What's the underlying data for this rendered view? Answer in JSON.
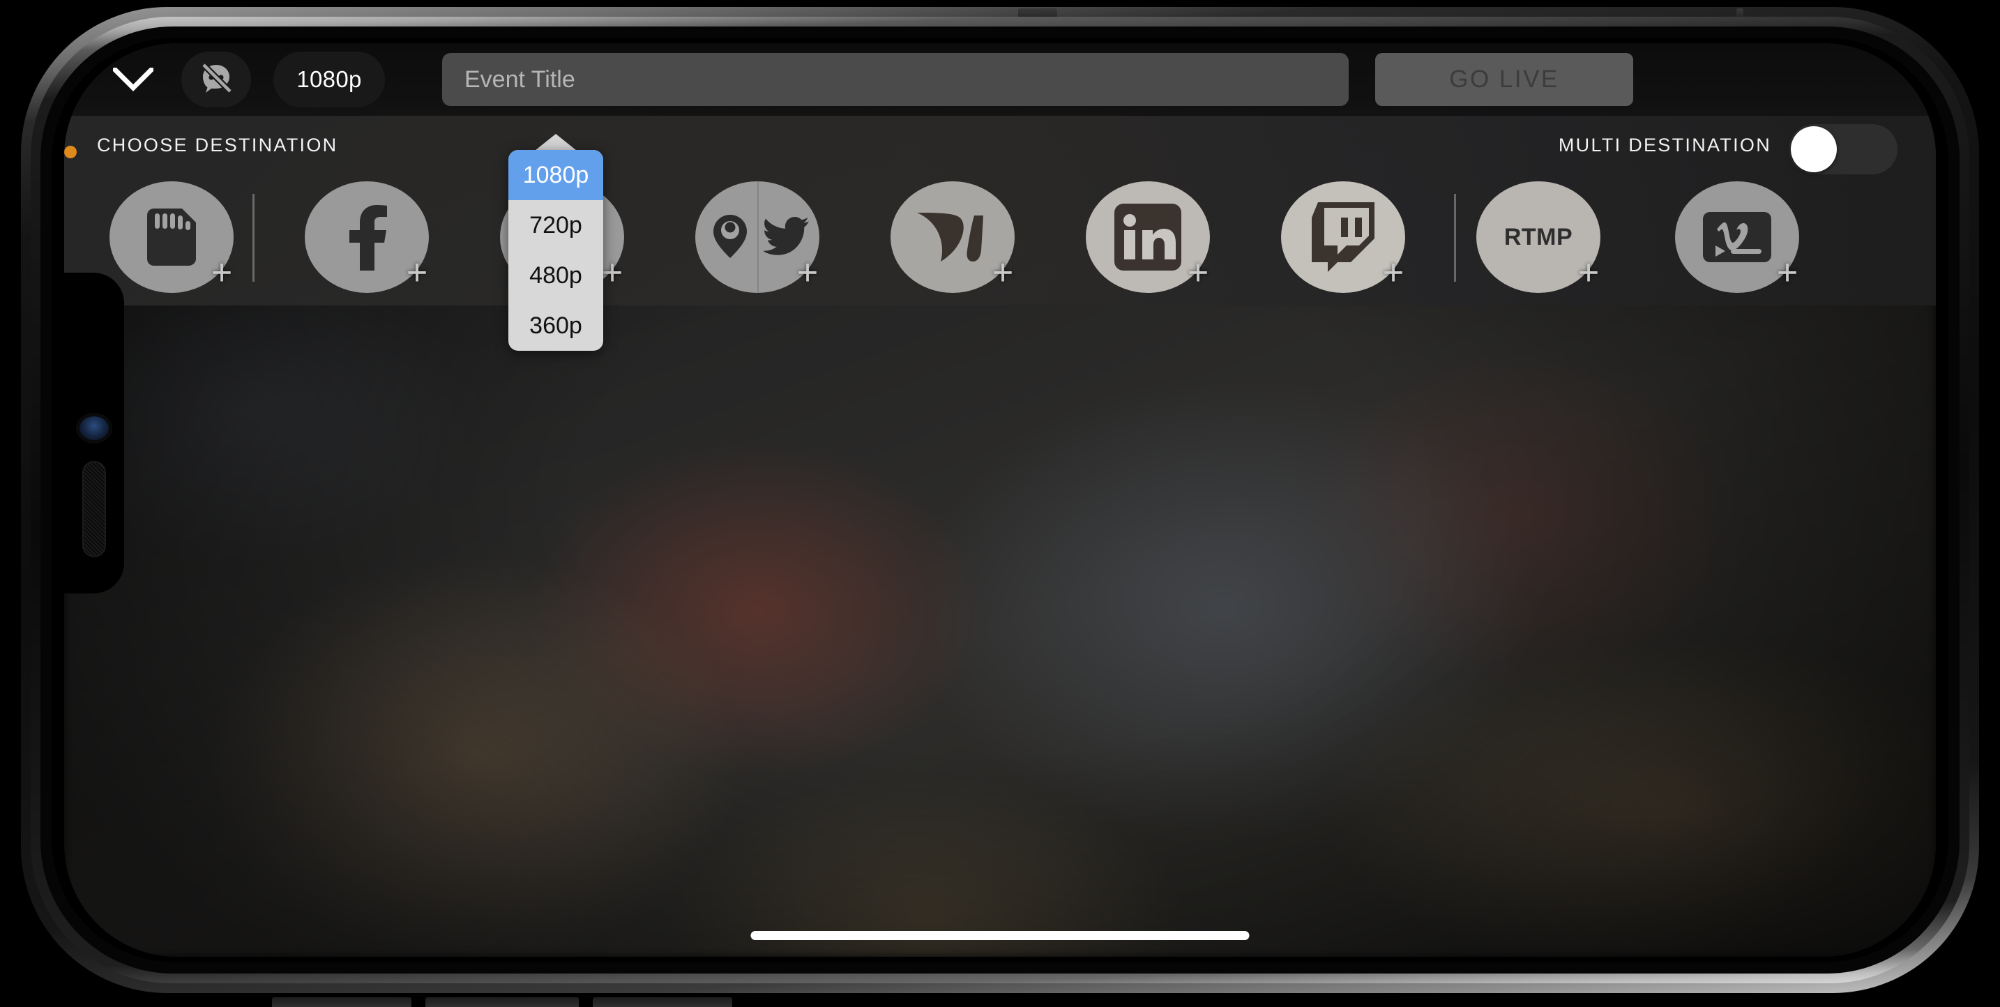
{
  "app": {
    "topbar": {
      "collapse_icon": "chevron-down-icon",
      "camera_toggle_icon": "comment-off-icon",
      "resolution_label": "1080p",
      "event_title_placeholder": "Event Title",
      "event_title_value": "",
      "go_live_label": "GO LIVE"
    },
    "destination_panel": {
      "choose_label": "CHOOSE DESTINATION",
      "multi_label": "MULTI DESTINATION",
      "multi_enabled": false,
      "destinations": [
        {
          "id": "sd-card",
          "icon": "sd-card-icon",
          "label": "",
          "add": "+",
          "group": 0
        },
        {
          "id": "facebook",
          "icon": "facebook-icon",
          "label": "",
          "add": "+",
          "group": 1
        },
        {
          "id": "youtube",
          "icon": "youtube-icon",
          "label": "",
          "add": "+",
          "group": 1
        },
        {
          "id": "periscope-twitter",
          "icon": "periscope-twitter-icon",
          "label": "",
          "add": "+",
          "group": 1
        },
        {
          "id": "wowza",
          "icon": "wowza-icon",
          "label": "",
          "add": "+",
          "group": 1
        },
        {
          "id": "linkedin",
          "icon": "linkedin-icon",
          "label": "",
          "add": "+",
          "group": 1
        },
        {
          "id": "twitch",
          "icon": "twitch-icon",
          "label": "",
          "add": "+",
          "group": 1
        },
        {
          "id": "rtmp",
          "icon": "rtmp-text-icon",
          "label": "RTMP",
          "add": "+",
          "group": 1
        },
        {
          "id": "vimeo",
          "icon": "vimeo-livestream-icon",
          "label": "",
          "add": "+",
          "group": 2
        }
      ]
    },
    "resolution_menu": {
      "open": true,
      "selected": "1080p",
      "options": [
        "1080p",
        "720p",
        "480p",
        "360p"
      ]
    },
    "system": {
      "home_indicator": true,
      "recording_dot": true
    },
    "colors": {
      "accent_selected": "#62a0ec",
      "menu_background": "#d8d8d8",
      "panel_background": "#2a2a2a",
      "topbar_background": "#101010",
      "input_background": "#4b4b4b",
      "go_live_background": "#5a5a5a",
      "go_live_text": "#3c3c3c",
      "recording_dot": "#e08a1e"
    }
  }
}
